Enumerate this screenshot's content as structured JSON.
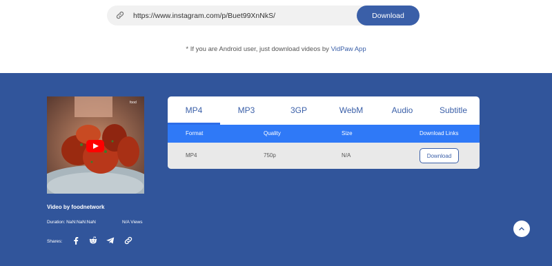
{
  "search": {
    "url_value": "https://www.instagram.com/p/Buet99XnNkS/",
    "download_label": "Download",
    "link_icon": "link-icon"
  },
  "note": {
    "text": "* If you are Android user, just download videos by ",
    "link_text": "VidPaw App"
  },
  "video": {
    "thumbnail_logo": "food",
    "title": "Video by foodnetwork",
    "duration": "Duration: NaN:NaN:NaN",
    "views": "N/A Views",
    "shares_label": "Shares:",
    "share_icons": [
      "facebook-icon",
      "reddit-icon",
      "telegram-icon",
      "link-icon"
    ]
  },
  "tabs": [
    {
      "label": "MP4",
      "active": true
    },
    {
      "label": "MP3",
      "active": false
    },
    {
      "label": "3GP",
      "active": false
    },
    {
      "label": "WebM",
      "active": false
    },
    {
      "label": "Audio",
      "active": false
    },
    {
      "label": "Subtitle",
      "active": false
    }
  ],
  "table": {
    "headers": [
      "Format",
      "Quality",
      "Size",
      "Download Links"
    ],
    "rows": [
      {
        "format": "MP4",
        "quality": "750p",
        "size": "N/A",
        "download_label": "Download"
      }
    ]
  },
  "colors": {
    "primary": "#3a5fa8",
    "footer_bg": "#31559b",
    "table_header": "#2f79f7",
    "youtube_red": "#ff0000"
  }
}
